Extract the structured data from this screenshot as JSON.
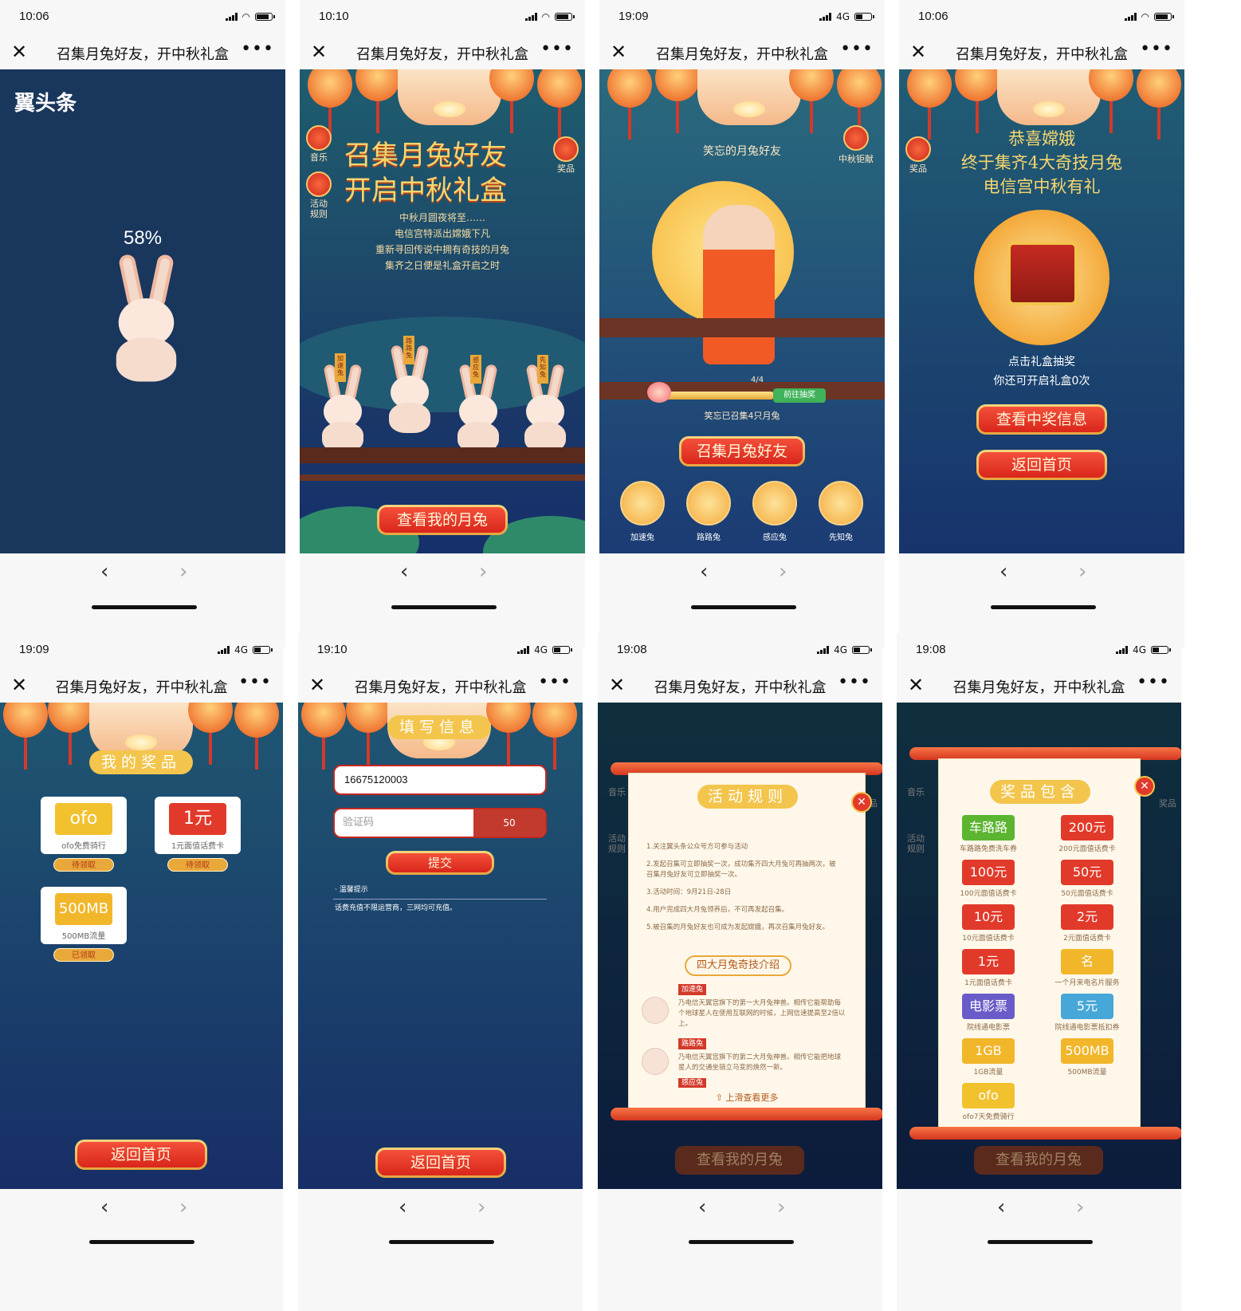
{
  "nav": {
    "title": "召集月兔好友，开中秋礼盒",
    "close": "✕",
    "more": "•••"
  },
  "toolbar": {
    "back": "‹",
    "forward": "›"
  },
  "screens": [
    {
      "time": "10:06",
      "network": "",
      "brand": "翼头条",
      "progress": "58%"
    },
    {
      "time": "10:10",
      "network": "",
      "left_buttons": [
        "音乐",
        "活动规则"
      ],
      "right_button": "奖品",
      "title1": "召集月兔好友",
      "title2": "开启中秋礼盒",
      "story": [
        "中秋月圆夜将至……",
        "电信宫特派出嫦娥下凡",
        "重新寻回传说中拥有奇技的月兔",
        "集齐之日便是礼盒开启之时"
      ],
      "rabbit_tags": [
        "加速兔",
        "路路兔",
        "感应兔",
        "先知兔"
      ],
      "cta": "查看我的月兔"
    },
    {
      "time": "19:09",
      "network": "4G",
      "name": "笑忘的月兔好友",
      "right_button": "中秋钜献",
      "progress_label": "4/4",
      "progress_value": 1.0,
      "go_draw": "前往抽奖",
      "collected": "笑忘已召集4只月兔",
      "cta": "召集月兔好友",
      "rabbits": [
        "加速兔",
        "路路兔",
        "感应兔",
        "先知兔"
      ]
    },
    {
      "time": "10:06",
      "network": "",
      "left_button": "奖品",
      "congrats": [
        "恭喜嫦娥",
        "终于集齐4大奇技月兔",
        "电信宫中秋有礼"
      ],
      "hint1": "点击礼盒抽奖",
      "hint2": "你还可开启礼盒0次",
      "btn_info": "查看中奖信息",
      "btn_home": "返回首页"
    },
    {
      "time": "19:09",
      "network": "4G",
      "heading": "我的奖品",
      "prizes": [
        {
          "logo": "ofo",
          "caption": "ofo免费骑行",
          "status": "待领取",
          "color": "#f2c12e"
        },
        {
          "logo": "1元",
          "caption": "1元面值话费卡",
          "status": "待领取",
          "color": "#e23a2a"
        },
        {
          "logo": "500MB",
          "caption": "500MB流量",
          "status": "已领取",
          "color": "#f2b62a"
        }
      ],
      "btn_home": "返回首页"
    },
    {
      "time": "19:10",
      "network": "4G",
      "heading": "填写信息",
      "phone_value": "16675120003",
      "code_placeholder": "验证码",
      "countdown": "50",
      "submit": "提交",
      "tip_title": "· 温馨提示",
      "tip_text": "话费充值不限运营商，三网均可充值。",
      "btn_home": "返回首页"
    },
    {
      "time": "19:08",
      "network": "4G",
      "side_left": [
        "音乐",
        "活动规则"
      ],
      "side_right": "奖品",
      "heading": "活动规则",
      "rules": [
        "1.关注翼头条公众号方可参与活动",
        "2.发起召集可立即抽奖一次，成功集齐四大月兔可再抽两次，被召集月兔好友可立即抽奖一次。",
        "3.活动时间：9月21日-28日",
        "4.用户完成四大月兔领养后，不可再发起召集。",
        "5.被召集的月兔好友也可成为发起嫦娥，再次召集月兔好友。"
      ],
      "intro_heading": "四大月兔奇技介绍",
      "intros": [
        {
          "tag": "加速兔",
          "text": "乃电信天翼宫旗下的第一大月兔神兽。相传它能帮助每个地球星人在使用互联网的时候，上网信速提高至2倍以上。"
        },
        {
          "tag": "路路兔",
          "text": "乃电信天翼宫旗下的第二大月兔神兽。相传它能把地球星人的交通坐骑立马变的焕然一新。"
        },
        {
          "tag": "感应兔",
          "text": ""
        }
      ],
      "more": "上滑查看更多",
      "bg_cta": "查看我的月兔"
    },
    {
      "time": "19:08",
      "network": "4G",
      "side_left": [
        "音乐",
        "活动规则"
      ],
      "side_right": "奖品",
      "heading": "奖品包含",
      "items": [
        {
          "logo": "车路路",
          "caption": "车路路免费洗车券",
          "color": "#5cb531"
        },
        {
          "logo": "200元",
          "caption": "200元面值话费卡",
          "color": "#e23a2a"
        },
        {
          "logo": "100元",
          "caption": "100元面值话费卡",
          "color": "#e23a2a"
        },
        {
          "logo": "50元",
          "caption": "50元面值话费卡",
          "color": "#e23a2a"
        },
        {
          "logo": "10元",
          "caption": "10元面值话费卡",
          "color": "#e23a2a"
        },
        {
          "logo": "2元",
          "caption": "2元面值话费卡",
          "color": "#e23a2a"
        },
        {
          "logo": "1元",
          "caption": "1元面值话费卡",
          "color": "#e23a2a"
        },
        {
          "logo": "名",
          "caption": "一个月来电名片服务",
          "color": "#f2b62a"
        },
        {
          "logo": "电影票",
          "caption": "院线通电影票",
          "color": "#6a5cc8"
        },
        {
          "logo": "5元",
          "caption": "院线通电影票抵扣券",
          "color": "#46a7d8"
        },
        {
          "logo": "1GB",
          "caption": "1GB流量",
          "color": "#f2b62a"
        },
        {
          "logo": "500MB",
          "caption": "500MB流量",
          "color": "#f2b62a"
        },
        {
          "logo": "ofo",
          "caption": "ofo7天免费骑行",
          "color": "#f2c12e"
        }
      ],
      "bg_cta": "查看我的月兔"
    }
  ]
}
